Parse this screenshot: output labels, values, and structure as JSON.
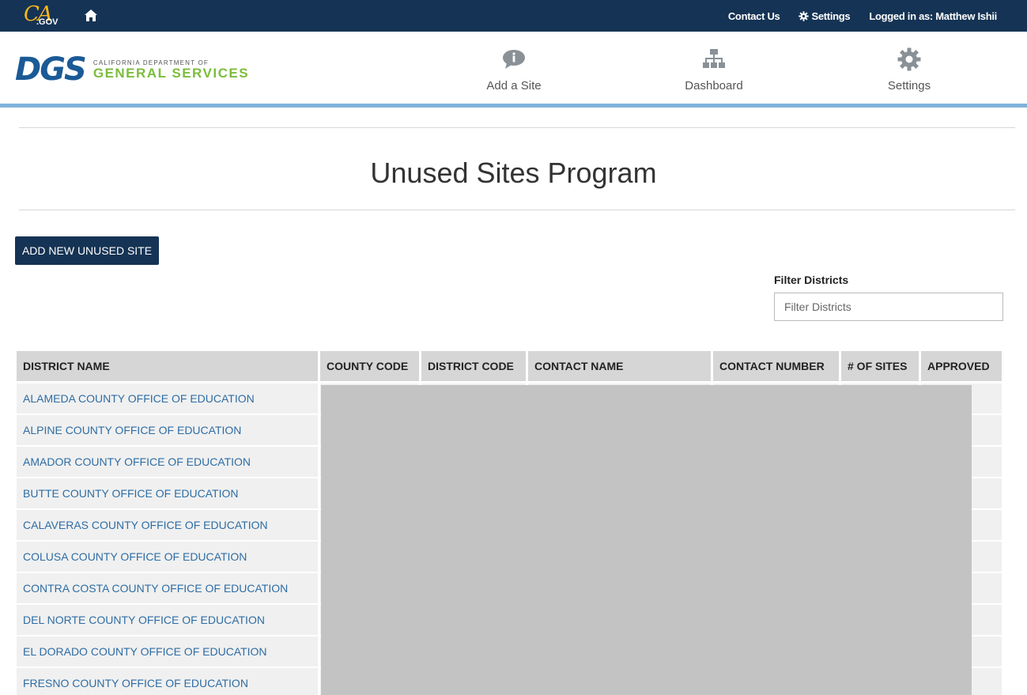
{
  "utility_bar": {
    "logo_ca": "CA",
    "logo_gov": ".GOV",
    "contact_us": "Contact Us",
    "settings": "Settings",
    "logged_in": "Logged in as: Matthew Ishii"
  },
  "header": {
    "dgs_mark": "DGS",
    "dgs_sub": "CALIFORNIA DEPARTMENT OF",
    "dgs_main": "GENERAL SERVICES",
    "nav": [
      {
        "label": "Add a Site",
        "icon": "info-speech-icon"
      },
      {
        "label": "Dashboard",
        "icon": "sitemap-icon"
      },
      {
        "label": "Settings",
        "icon": "gear-icon"
      }
    ]
  },
  "main": {
    "title": "Unused Sites Program",
    "add_button": "ADD NEW UNUSED SITE",
    "filter_label": "Filter Districts",
    "filter_placeholder": "Filter Districts",
    "filter_value": ""
  },
  "table": {
    "columns": [
      "DISTRICT NAME",
      "COUNTY CODE",
      "DISTRICT CODE",
      "CONTACT NAME",
      "CONTACT NUMBER",
      "# OF SITES",
      "APPROVED"
    ],
    "rows": [
      "ALAMEDA COUNTY OFFICE OF EDUCATION",
      "ALPINE COUNTY OFFICE OF EDUCATION",
      "AMADOR COUNTY OFFICE OF EDUCATION",
      "BUTTE COUNTY OFFICE OF EDUCATION",
      "CALAVERAS COUNTY OFFICE OF EDUCATION",
      "COLUSA COUNTY OFFICE OF EDUCATION",
      "CONTRA COSTA COUNTY OFFICE OF EDUCATION",
      "DEL NORTE COUNTY OFFICE OF EDUCATION",
      "EL DORADO COUNTY OFFICE OF EDUCATION",
      "FRESNO COUNTY OFFICE OF EDUCATION"
    ]
  },
  "colors": {
    "navy": "#153354",
    "accent_blue": "#7fb3da",
    "link_blue": "#2e6da4",
    "dgs_green": "#7bbd3c",
    "ca_gold": "#fdb81e"
  }
}
